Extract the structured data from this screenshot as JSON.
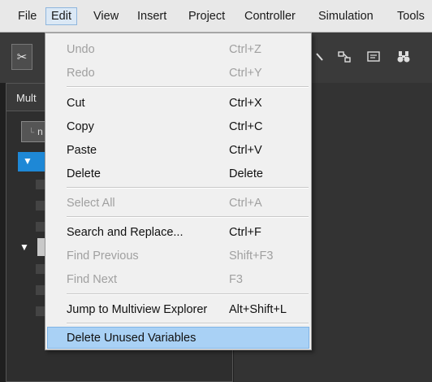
{
  "menubar": {
    "items": [
      "File",
      "Edit",
      "View",
      "Insert",
      "Project",
      "Controller",
      "Simulation",
      "Tools"
    ],
    "active": "Edit"
  },
  "left_pane": {
    "title": "Mult",
    "dropdown_value": "n"
  },
  "edit_menu": {
    "items": [
      {
        "label": "Undo",
        "shortcut": "Ctrl+Z",
        "enabled": false
      },
      {
        "label": "Redo",
        "shortcut": "Ctrl+Y",
        "enabled": false
      },
      {
        "label": "Cut",
        "shortcut": "Ctrl+X",
        "enabled": true
      },
      {
        "label": "Copy",
        "shortcut": "Ctrl+C",
        "enabled": true
      },
      {
        "label": "Paste",
        "shortcut": "Ctrl+V",
        "enabled": true
      },
      {
        "label": "Delete",
        "shortcut": "Delete",
        "enabled": true
      },
      {
        "label": "Select All",
        "shortcut": "Ctrl+A",
        "enabled": false
      },
      {
        "label": "Search and Replace...",
        "shortcut": "Ctrl+F",
        "enabled": true
      },
      {
        "label": "Find Previous",
        "shortcut": "Shift+F3",
        "enabled": false
      },
      {
        "label": "Find Next",
        "shortcut": "F3",
        "enabled": false
      },
      {
        "label": "Jump to Multiview Explorer",
        "shortcut": "Alt+Shift+L",
        "enabled": true
      },
      {
        "label": "Delete Unused Variables",
        "shortcut": "",
        "enabled": true,
        "highlighted": true
      }
    ]
  },
  "toolbar": {
    "icons": [
      "cut-icon",
      "transfer-icon",
      "cross-reference-icon",
      "binoculars-icon"
    ]
  }
}
